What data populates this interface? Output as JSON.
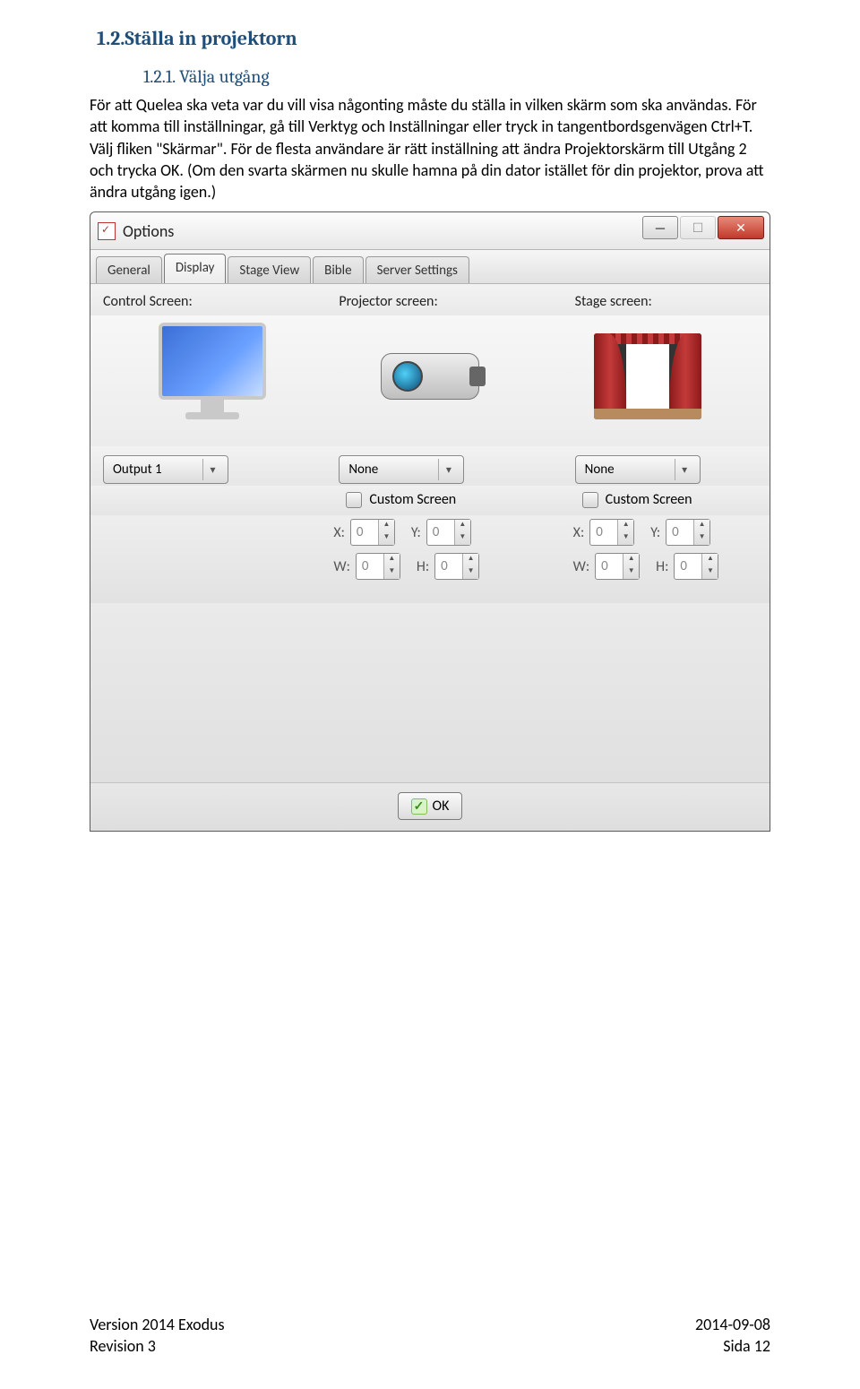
{
  "doc": {
    "heading1": "1.2.Ställa in projektorn",
    "heading2": "1.2.1. Välja utgång",
    "paragraph": "För att Quelea ska veta var du vill visa någonting måste du ställa in vilken skärm som ska användas. För att komma till inställningar, gå till Verktyg och Inställningar eller tryck in tangentbordsgenvägen Ctrl+T. Välj fliken \"Skärmar\". För de flesta användare är rätt inställning att ändra Projektorskärm till Utgång 2 och trycka OK. (Om den svarta skärmen nu skulle hamna på din dator istället för din projektor, prova att ändra utgång igen.)"
  },
  "window": {
    "title": "Options",
    "tabs": [
      "General",
      "Display",
      "Stage View",
      "Bible",
      "Server Settings"
    ],
    "active_tab": 1,
    "columns": {
      "control": "Control Screen:",
      "projector": "Projector screen:",
      "stage": "Stage screen:"
    },
    "dropdowns": {
      "control": "Output 1",
      "projector": "None",
      "stage": "None"
    },
    "custom_label": "Custom Screen",
    "spin": {
      "x": "X:",
      "y": "Y:",
      "w": "W:",
      "h": "H:",
      "value": "0"
    },
    "ok": "OK"
  },
  "footer": {
    "left1": "Version 2014 Exodus",
    "left2": "Revision 3",
    "right1": "2014-09-08",
    "right2": "Sida 12"
  }
}
